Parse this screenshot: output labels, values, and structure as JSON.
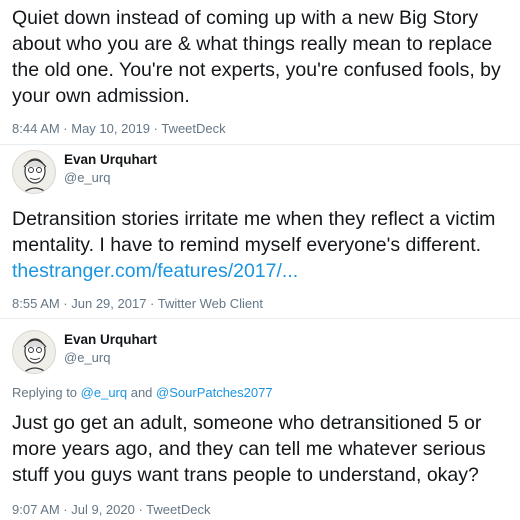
{
  "tweets": [
    {
      "text": "Quiet down instead of coming up with a new Big Story about who you are & what things really mean to replace the old one. You're not experts, you're confused fools, by your own admission.",
      "meta": "8:44 AM · May 10, 2019 · TweetDeck"
    },
    {
      "author": {
        "name": "Evan Urquhart",
        "handle": "@e_urq"
      },
      "text": "Detransition stories irritate me when they reflect a victim mentality. I have to remind myself everyone's different. ",
      "link": "thestranger.com/features/2017/...",
      "meta": "8:55 AM · Jun 29, 2017 · Twitter Web Client"
    },
    {
      "author": {
        "name": "Evan Urquhart",
        "handle": "@e_urq"
      },
      "reply": {
        "prefix": "Replying to ",
        "user1": "@e_urq",
        "joiner": " and ",
        "user2": "@SourPatches2077"
      },
      "text": "Just go get an adult, someone who detransitioned 5 or more years ago, and they can tell me whatever serious stuff you guys want trans people to understand, okay?",
      "meta": "9:07 AM · Jul 9, 2020 · TweetDeck"
    }
  ]
}
